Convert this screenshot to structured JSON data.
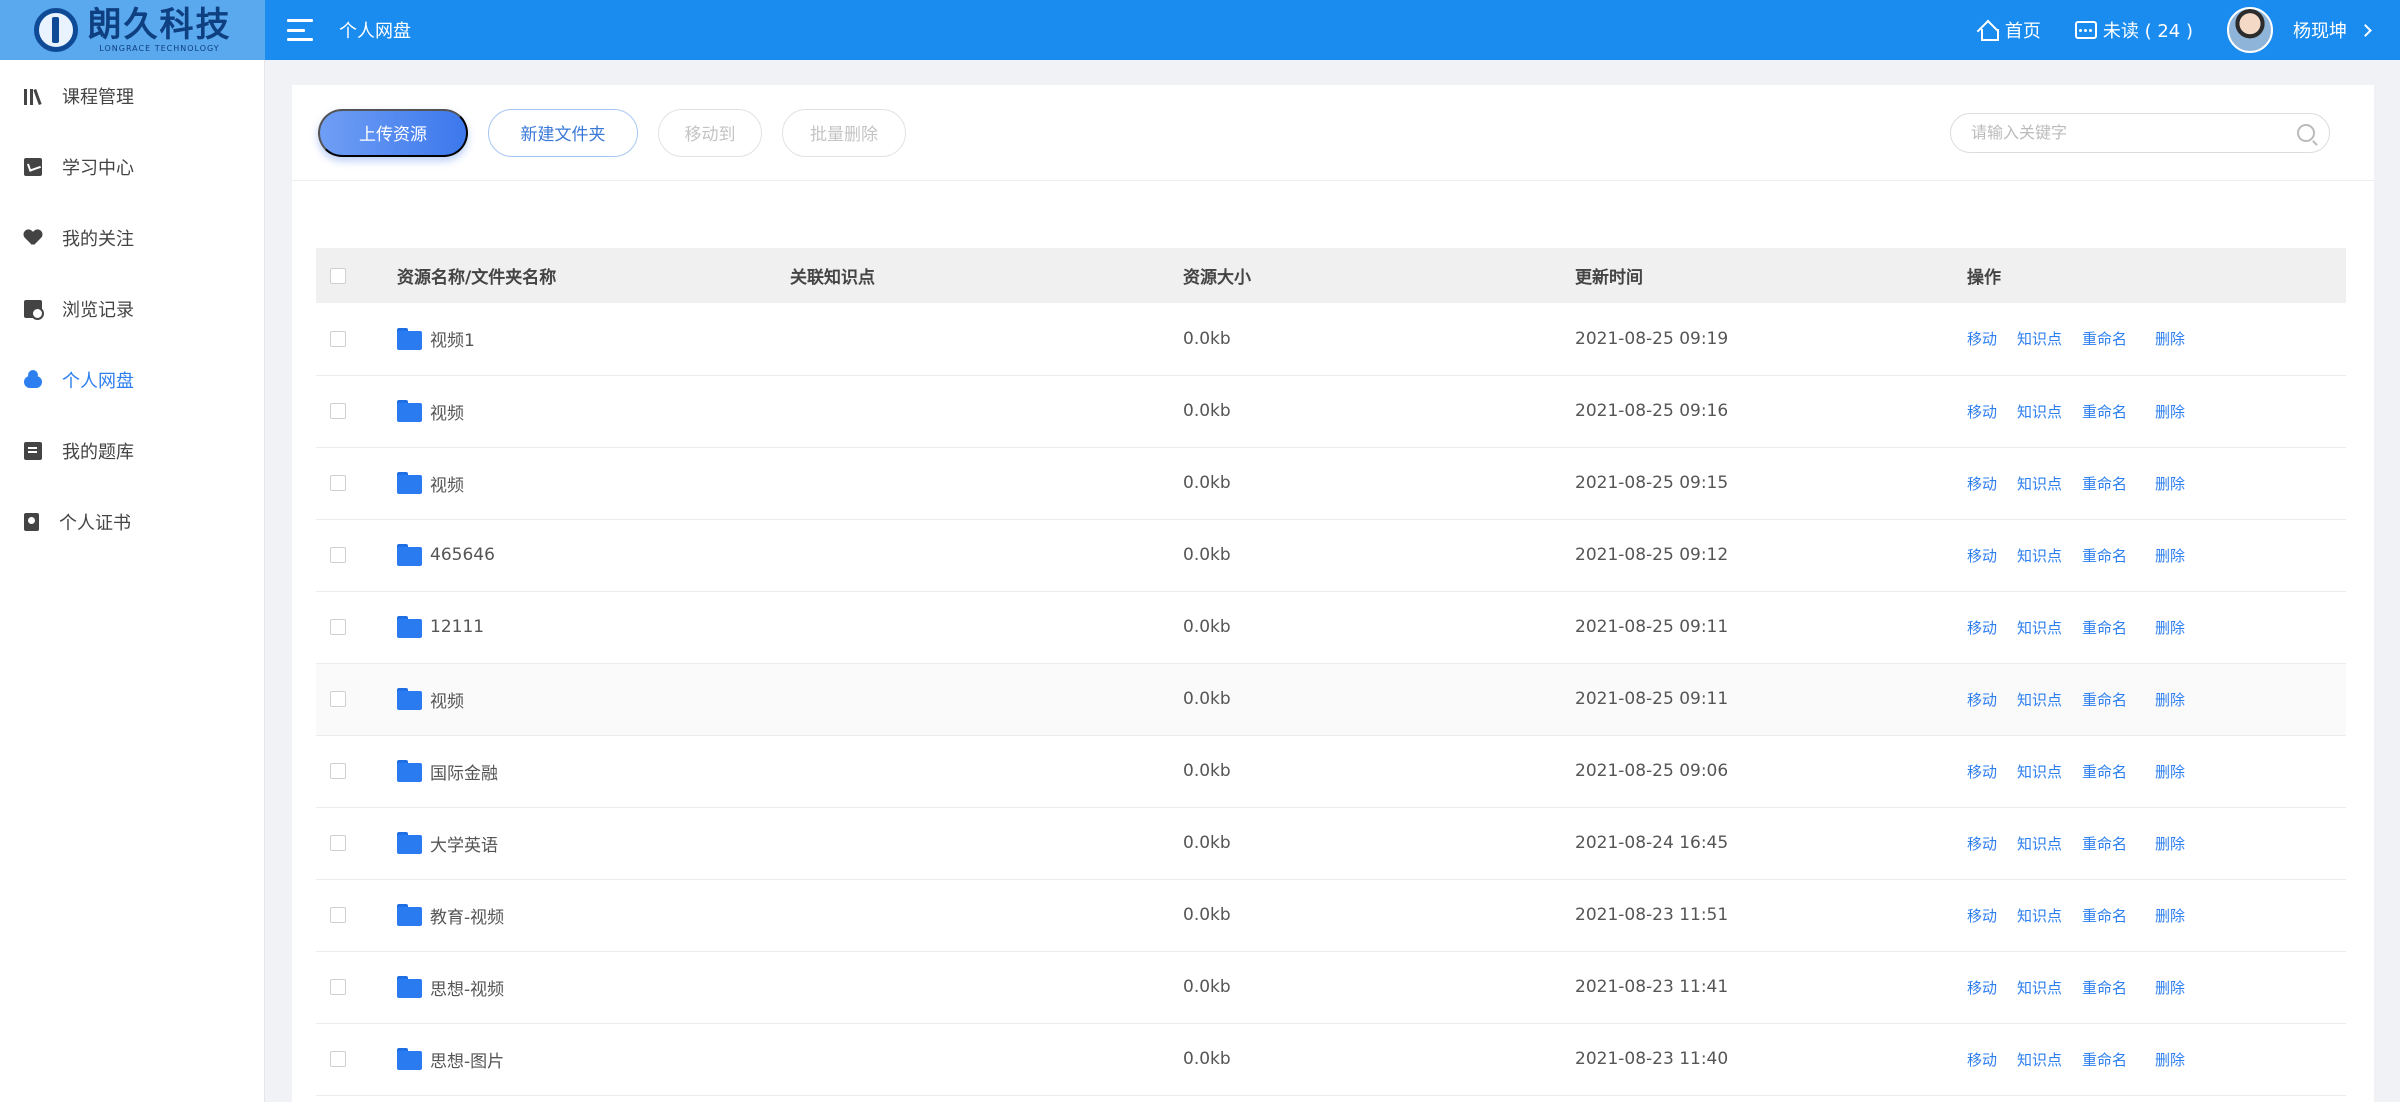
{
  "header": {
    "logo_cn": "朗久科技",
    "logo_en": "LONGRACE TECHNOLOGY",
    "title": "个人网盘",
    "home": "首页",
    "unread": "未读 ( 24 )",
    "user": "杨现坤"
  },
  "sidebar": {
    "items": [
      {
        "label": "课程管理",
        "icon": "books-icon"
      },
      {
        "label": "学习中心",
        "icon": "learning-icon"
      },
      {
        "label": "我的关注",
        "icon": "heart-icon"
      },
      {
        "label": "浏览记录",
        "icon": "history-icon"
      },
      {
        "label": "个人网盘",
        "icon": "cloud-icon",
        "active": true
      },
      {
        "label": "我的题库",
        "icon": "question-bank-icon"
      },
      {
        "label": "个人证书",
        "icon": "certificate-icon"
      }
    ]
  },
  "toolbar": {
    "upload": "上传资源",
    "new_folder": "新建文件夹",
    "move_to": "移动到",
    "batch_delete": "批量删除",
    "search_placeholder": "请输入关键字"
  },
  "table": {
    "headers": [
      "资源名称/文件夹名称",
      "关联知识点",
      "资源大小",
      "更新时间",
      "操作"
    ],
    "actions": [
      "移动",
      "知识点",
      "重命名",
      "删除"
    ],
    "rows": [
      {
        "name": "视频1",
        "knowledge": "",
        "size": "0.0kb",
        "time": "2021-08-25 09:19"
      },
      {
        "name": "视频",
        "knowledge": "",
        "size": "0.0kb",
        "time": "2021-08-25 09:16"
      },
      {
        "name": "视频",
        "knowledge": "",
        "size": "0.0kb",
        "time": "2021-08-25 09:15"
      },
      {
        "name": "465646",
        "knowledge": "",
        "size": "0.0kb",
        "time": "2021-08-25 09:12"
      },
      {
        "name": "12111",
        "knowledge": "",
        "size": "0.0kb",
        "time": "2021-08-25 09:11"
      },
      {
        "name": "视频",
        "knowledge": "",
        "size": "0.0kb",
        "time": "2021-08-25 09:11"
      },
      {
        "name": "国际金融",
        "knowledge": "",
        "size": "0.0kb",
        "time": "2021-08-25 09:06"
      },
      {
        "name": "大学英语",
        "knowledge": "",
        "size": "0.0kb",
        "time": "2021-08-24 16:45"
      },
      {
        "name": "教育-视频",
        "knowledge": "",
        "size": "0.0kb",
        "time": "2021-08-23 11:51"
      },
      {
        "name": "思想-视频",
        "knowledge": "",
        "size": "0.0kb",
        "time": "2021-08-23 11:41"
      },
      {
        "name": "思想-图片",
        "knowledge": "",
        "size": "0.0kb",
        "time": "2021-08-23 11:40"
      }
    ]
  },
  "colors": {
    "brand": "#1a8cf0",
    "accent": "#2d7ff0"
  }
}
